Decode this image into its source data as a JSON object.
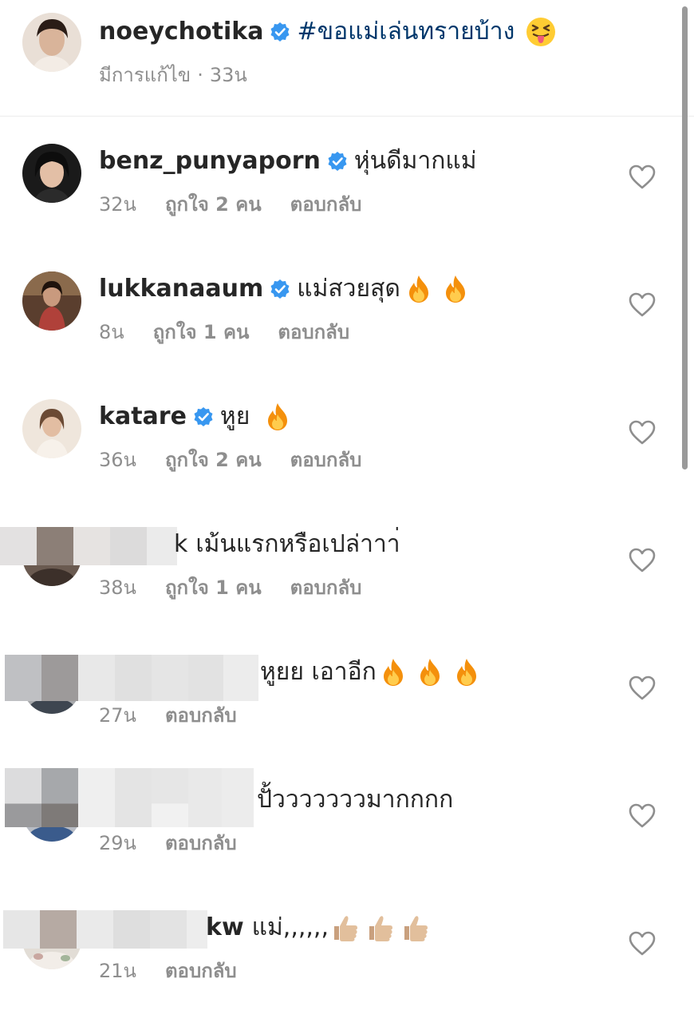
{
  "caption": {
    "username": "noeychotika",
    "verified": true,
    "text": "#ขอแม่เล่นทรายบ้าง",
    "emoji": "squinting-face-with-tongue-emoji",
    "edited_label": "มีการแก้ไข",
    "separator": "·",
    "time": "33น"
  },
  "comments": [
    {
      "username": "benz_punyaporn",
      "verified": true,
      "text": "หุ่นดีมากแม่",
      "emoji_count": 0,
      "time": "32น",
      "likes": "ถูกใจ 2 คน",
      "reply": "ตอบกลับ"
    },
    {
      "username": "lukkanaaum",
      "verified": true,
      "text": "แม่สวยสุด",
      "emoji": "fire-emoji",
      "emoji_count": 2,
      "time": "8น",
      "likes": "ถูกใจ 1 คน",
      "reply": "ตอบกลับ"
    },
    {
      "username": "katare",
      "verified": true,
      "text": "หูย",
      "emoji": "fire-emoji",
      "emoji_count": 1,
      "time": "36น",
      "likes": "ถูกใจ 2 คน",
      "reply": "ตอบกลับ"
    },
    {
      "username": "",
      "username_visible_fragment": "k",
      "redacted": true,
      "text": "เม้นแรกหรือเปล่าาา่",
      "emoji_count": 0,
      "time": "38น",
      "likes": "ถูกใจ 1 คน",
      "reply": "ตอบกลับ"
    },
    {
      "username": "",
      "redacted": true,
      "text": "หูยย เอาอีก",
      "emoji": "fire-emoji",
      "emoji_count": 3,
      "time": "27น",
      "likes": "",
      "reply": "ตอบกลับ"
    },
    {
      "username": "",
      "redacted": true,
      "text": "ปั้วววววววมากกกก",
      "emoji_count": 0,
      "time": "29น",
      "likes": "",
      "reply": "ตอบกลับ"
    },
    {
      "username": "",
      "username_visible_fragment": "kw",
      "redacted": true,
      "text": "แม่,,,,,,",
      "emoji": "thumbs-up-emoji",
      "emoji_count": 3,
      "time": "21น",
      "likes": "",
      "reply": "ตอบกลับ"
    }
  ],
  "colors": {
    "text": "#262626",
    "secondary": "#8e8e8e",
    "hashtag": "#00376b",
    "verified": "#3897f0",
    "divider": "#ececec"
  }
}
